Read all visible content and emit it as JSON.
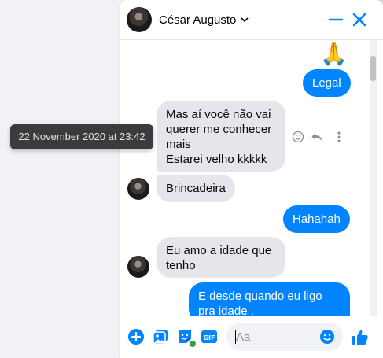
{
  "header": {
    "contact_name": "César Augusto"
  },
  "messages": {
    "emoji": "🙏",
    "legal": "Legal",
    "mas": "Mas aí você não vai\nquerer me conhecer\nmais\nEstarei velho kkkkk",
    "brincadeira": "Brincadeira",
    "hahahah": "Hahahah",
    "amo": "Eu amo a idade que\ntenho",
    "edesde": "E desde quando eu ligo\npra idade ."
  },
  "tooltip": {
    "text": "22 November 2020 at 23:42"
  },
  "composer": {
    "gif_label": "GIF",
    "placeholder": "Aa"
  },
  "colors": {
    "accent": "#0084ff",
    "incoming": "#e4e6eb",
    "online": "#31a24c"
  },
  "icons": [
    "chevron-down-icon",
    "minimize-icon",
    "close-icon",
    "smiley-icon",
    "reply-icon",
    "more-icon",
    "plus-icon",
    "photo-icon",
    "sticker-icon",
    "gif-icon",
    "emoji-icon",
    "thumbs-up-icon"
  ]
}
